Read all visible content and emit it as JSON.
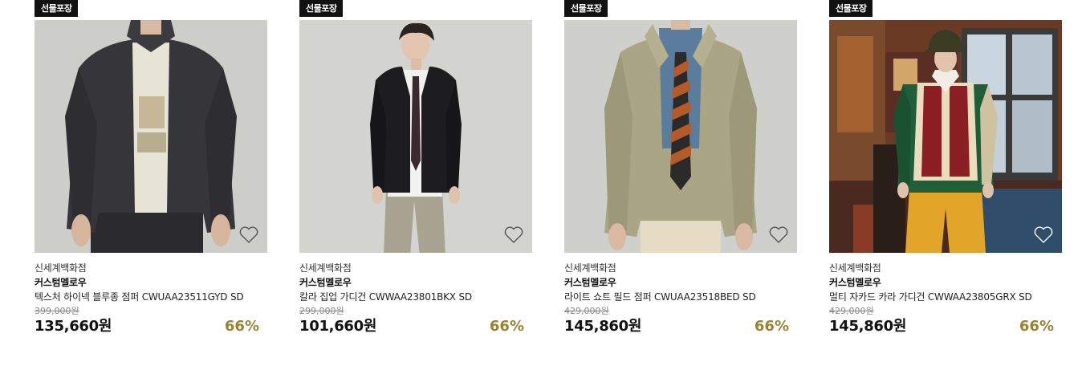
{
  "products": [
    {
      "badge": "선물포장",
      "store": "신세계백화점",
      "brand": "커스텀멜로우",
      "name": "텍스처 하이넥 블루종 점퍼 CWUAA23511GYD SD",
      "original_price": "399,000원",
      "sale_price": "135,660원",
      "discount": "66%",
      "image": "model-dark-gray-blouson"
    },
    {
      "badge": "선물포장",
      "store": "신세계백화점",
      "brand": "커스텀멜로우",
      "name": "칼라 집업 가디건 CWWAA23801BKX SD",
      "original_price": "299,000원",
      "sale_price": "101,660원",
      "discount": "66%",
      "image": "model-black-zip-cardigan"
    },
    {
      "badge": "선물포장",
      "store": "신세계백화점",
      "brand": "커스텀멜로우",
      "name": "라이트 쇼트 필드 점퍼 CWUAA23518BED SD",
      "original_price": "429,000원",
      "sale_price": "145,860원",
      "discount": "66%",
      "image": "model-beige-field-jacket"
    },
    {
      "badge": "선물포장",
      "store": "신세계백화점",
      "brand": "커스텀멜로우",
      "name": "멀티 자카드 카라 가디건 CWWAA23805GRX SD",
      "original_price": "429,000원",
      "sale_price": "145,860원",
      "discount": "66%",
      "image": "model-multicolor-jacquard-cardigan"
    }
  ],
  "colors": {
    "discount": "#9a8330",
    "badge_bg": "#111111"
  },
  "icons": {
    "wishlist": "heart-outline-icon"
  }
}
